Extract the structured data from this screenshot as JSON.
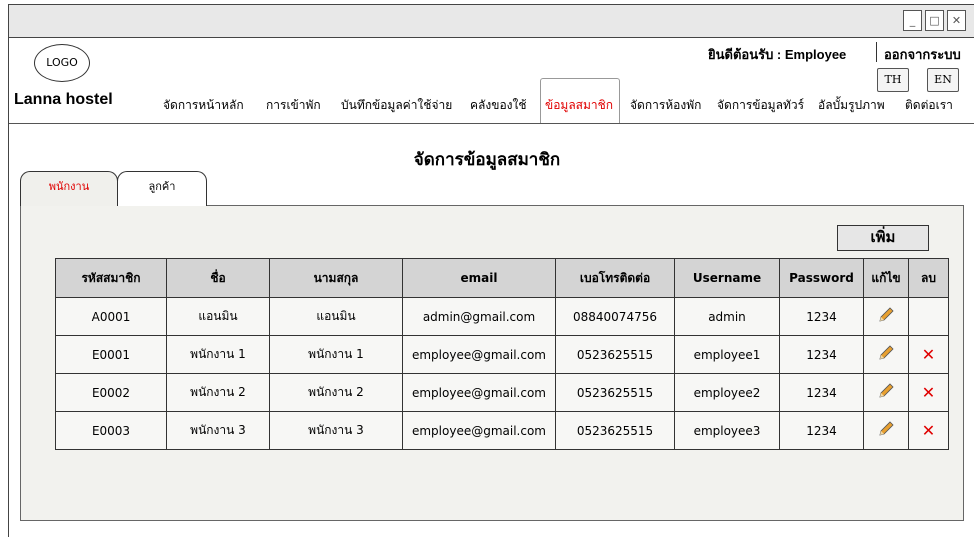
{
  "window": {
    "minimize": "_",
    "maximize": "□",
    "close": "✕"
  },
  "header": {
    "logo": "LOGO",
    "brand": "Lanna hostel",
    "welcome": "ยินดีต้อนรับ : Employee",
    "logout": "ออกจากระบบ",
    "lang_th": "TH",
    "lang_en": "EN"
  },
  "menu": [
    {
      "label": "จัดการหน้าหลัก",
      "active": false
    },
    {
      "label": "การเข้าพัก",
      "active": false
    },
    {
      "label": "บันทึกข้อมูลค่าใช้จ่าย",
      "active": false
    },
    {
      "label": "คลังของใช้",
      "active": false
    },
    {
      "label": "ข้อมูลสมาชิก",
      "active": true
    },
    {
      "label": "จัดการห้องพัก",
      "active": false
    },
    {
      "label": "จัดการข้อมูลทัวร์",
      "active": false
    },
    {
      "label": "อัลบั้มรูปภาพ",
      "active": false
    },
    {
      "label": "ติดต่อเรา",
      "active": false
    }
  ],
  "page_title": "จัดการข้อมูลสมาชิก",
  "tabs": [
    {
      "label": "พนักงาน",
      "active": true
    },
    {
      "label": "ลูกค้า",
      "active": false
    }
  ],
  "add_button": "เพิ่ม",
  "table": {
    "headers": [
      "รหัสสมาชิก",
      "ชื่อ",
      "นามสกุล",
      "email",
      "เบอโทรติดต่อ",
      "Username",
      "Password",
      "แก้ไข",
      "ลบ"
    ],
    "rows": [
      {
        "cells": [
          "A0001",
          "แอนมิน",
          "แอนมิน",
          "admin@gmail.com",
          "08840074756",
          "admin",
          "1234"
        ],
        "editable": true,
        "deletable": false
      },
      {
        "cells": [
          "E0001",
          "พนักงาน 1",
          "พนักงาน 1",
          "employee@gmail.com",
          "0523625515",
          "employee1",
          "1234"
        ],
        "editable": true,
        "deletable": true
      },
      {
        "cells": [
          "E0002",
          "พนักงาน 2",
          "พนักงาน 2",
          "employee@gmail.com",
          "0523625515",
          "employee2",
          "1234"
        ],
        "editable": true,
        "deletable": true
      },
      {
        "cells": [
          "E0003",
          "พนักงาน 3",
          "พนักงาน 3",
          "employee@gmail.com",
          "0523625515",
          "employee3",
          "1234"
        ],
        "editable": true,
        "deletable": true
      }
    ]
  },
  "icons": {
    "edit": "pencil-icon",
    "delete": "close-x-icon"
  },
  "colors": {
    "active_red": "#e00000",
    "panel_bg": "#f2f2ee",
    "header_bg": "#d4d4d4"
  }
}
